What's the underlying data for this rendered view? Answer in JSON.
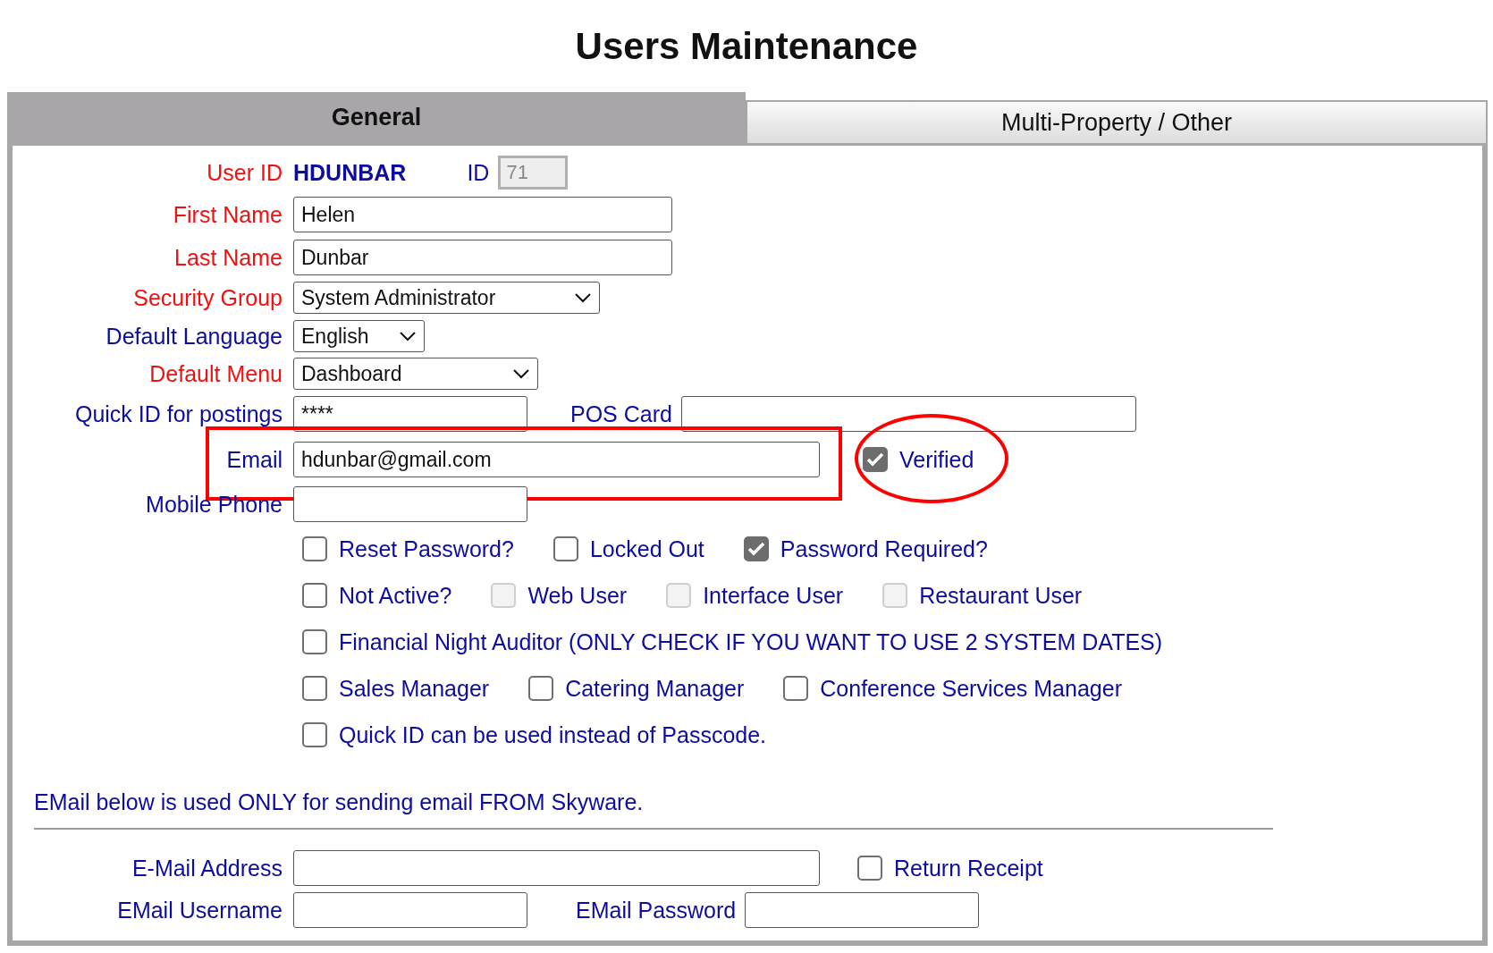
{
  "title": "Users Maintenance",
  "tabs": [
    {
      "label": "General",
      "selected": true
    },
    {
      "label": "Multi-Property / Other",
      "selected": false
    }
  ],
  "user_id": {
    "label": "User ID",
    "required": true,
    "value": "HDUNBAR",
    "id_label": "ID",
    "id_value": "71"
  },
  "first_name": {
    "label": "First Name",
    "required": true,
    "value": "Helen"
  },
  "last_name": {
    "label": "Last Name",
    "required": true,
    "value": "Dunbar"
  },
  "security_group": {
    "label": "Security Group",
    "required": true,
    "value": "System Administrator"
  },
  "default_language": {
    "label": "Default Language",
    "required": false,
    "value": "English"
  },
  "default_menu": {
    "label": "Default Menu",
    "required": true,
    "value": "Dashboard"
  },
  "quick_id": {
    "label": "Quick ID for postings",
    "required": false,
    "value": "****"
  },
  "pos_card": {
    "label": "POS Card"
  },
  "email": {
    "label": "Email",
    "required": false,
    "value": "hdunbar@gmail.com"
  },
  "verified": {
    "label": "Verified",
    "checked": true
  },
  "mobile_phone": {
    "label": "Mobile Phone",
    "required": false
  },
  "checkbox_rows": [
    [
      {
        "label": "Reset Password?",
        "checked": false,
        "disabled": false
      },
      {
        "label": "Locked Out",
        "checked": false,
        "disabled": false
      },
      {
        "label": "Password Required?",
        "checked": true,
        "disabled": false
      }
    ],
    [
      {
        "label": "Not Active?",
        "checked": false,
        "disabled": false
      },
      {
        "label": "Web User",
        "checked": false,
        "disabled": true
      },
      {
        "label": "Interface User",
        "checked": false,
        "disabled": true
      },
      {
        "label": "Restaurant User",
        "checked": false,
        "disabled": true
      }
    ],
    [
      {
        "label": "Financial Night Auditor (ONLY CHECK IF YOU WANT TO USE 2 SYSTEM DATES)",
        "checked": false,
        "disabled": false
      }
    ],
    [
      {
        "label": "Sales Manager",
        "checked": false,
        "disabled": false
      },
      {
        "label": "Catering Manager",
        "checked": false,
        "disabled": false
      },
      {
        "label": "Conference Services Manager",
        "checked": false,
        "disabled": false
      }
    ],
    [
      {
        "label": "Quick ID can be used instead of Passcode.",
        "checked": false,
        "disabled": false
      }
    ]
  ],
  "note": "EMail below is used ONLY for sending email FROM Skyware.",
  "email_address": {
    "label": "E-Mail Address"
  },
  "return_receipt": {
    "label": "Return Receipt",
    "checked": false
  },
  "email_username": {
    "label": "EMail Username"
  },
  "email_password": {
    "label": "EMail Password"
  }
}
